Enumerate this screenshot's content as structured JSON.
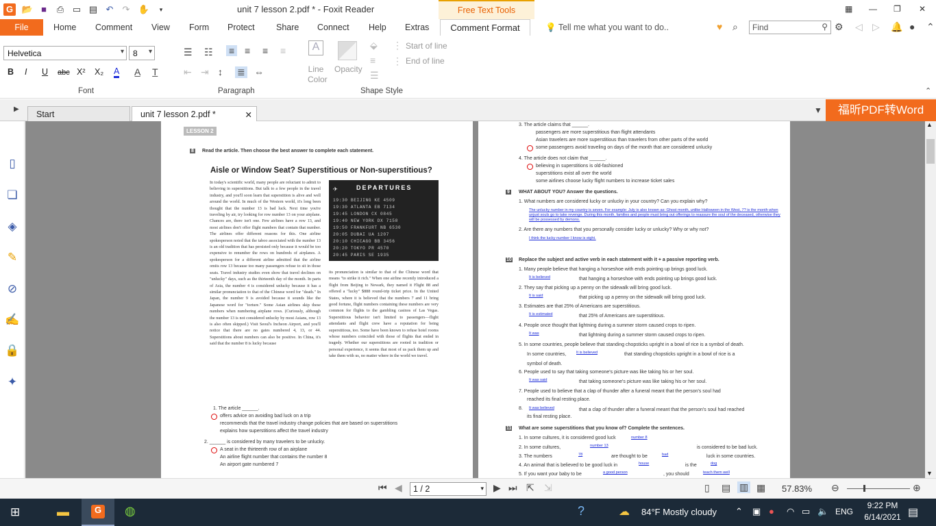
{
  "titlebar": {
    "title": "unit 7 lesson 2.pdf * - Foxit Reader",
    "context_tab": "Free Text Tools"
  },
  "tabs": {
    "file": "File",
    "home": "Home",
    "comment": "Comment",
    "view": "View",
    "form": "Form",
    "protect": "Protect",
    "share": "Share",
    "connect": "Connect",
    "help": "Help",
    "extras": "Extras",
    "comment_format": "Comment Format",
    "tellme": "Tell me what you want to do..",
    "find_placeholder": "Find"
  },
  "ribbon": {
    "font_name": "Helvetica",
    "font_size": "8",
    "bold": "B",
    "italic": "I",
    "underline": "U",
    "strike": "abc",
    "superscript": "X²",
    "subscript": "X₂",
    "font_color": "A",
    "group_font": "Font",
    "group_paragraph": "Paragraph",
    "group_shape": "Shape Style",
    "line_color": "Line Color",
    "opacity": "Opacity",
    "start_of_line": "Start of line",
    "end_of_line": "End of line"
  },
  "doctabs": {
    "start": "Start",
    "doc": "unit 7 lesson 2.pdf *",
    "banner": "福昕PDF转Word"
  },
  "page1": {
    "lesson": "LESSON 2",
    "letter": "8",
    "instruction": "Read the article. Then choose the best answer to complete each statement.",
    "headline": "Aisle or Window Seat? Superstitious or Non-superstitious?",
    "departures": "DEPARTURES",
    "dep_rows": [
      "19:30 BEIJING KE 4509",
      "19:30 ATLANTA EB 7134",
      "19:45 LONDON CX 0845",
      "19:40 NEW YORK DX 7158",
      "19:50 FRANKFURT NB 6530",
      "20:05 DUBAI UA 1207",
      "20:10 CHICAGO BB 3456",
      "20:20 TOKYO PR 4570",
      "20:45 PARIS SE 1935"
    ],
    "col1": "In today's scientific world, many people are reluctant to admit to believing in superstitions. But talk to a few people in the travel industry, and you'll soon learn that superstition is alive and well around the world. In much of the Western world, it's long been thought that the number 13 is bad luck. Next time you're traveling by air, try looking for row number 13 on your airplane. Chances are, there isn't one. Few airlines have a row 13, and most airlines don't offer flight numbers that contain that number. The airlines offer different reasons for this. One airline spokesperson noted that the taboo associated with the number 13 is an old tradition that has persisted only because it would be too expensive to renumber the rows on hundreds of airplanes. A spokesperson for a different airline admitted that the airline omits row 13 because too many passengers refuse to sit in those seats. Travel industry studies even show that travel declines on \"unlucky\" days, such as the thirteenth day of the month. In parts of Asia, the number 4 is considered unlucky because it has a similar pronunciation to that of the Chinese word for \"death.\" In Japan, the number 9 is avoided because it sounds like the Japanese word for \"torture.\" Some Asian airlines skip these numbers when numbering airplane rows. (Curiously, although the number 13 is not considered unlucky by most Asians, row 13 is also often skipped.) Visit Seoul's Incheon Airport, and you'll notice that there are no gates numbered 4, 13, or 44. Superstitions about numbers can also be positive. In China, it's said that the number 8 is lucky because",
    "col2": "its pronunciation is similar to that of the Chinese word that means \"to strike it rich.\" When one airline recently introduced a flight from Beijing to Newark, they named it Flight 88 and offered a \"lucky\" $888 round-trip ticket price. In the United States, where it is believed that the numbers 7 and 11 bring good fortune, flight numbers containing these numbers are very common for flights to the gambling casinos of Las Vegas. Superstitious behavior isn't limited to passengers—flight attendants and flight crew have a reputation for being superstitious, too. Some have been known to refuse hotel rooms whose numbers coincided with those of flights that ended in tragedy. Whether our superstitions are rooted in tradition or personal experience, it seems that most of us pack them up and take them with us, no matter where in the world we travel.",
    "q1": "1.  The article ______.",
    "q1a": "offers advice on avoiding bad luck on a trip",
    "q1b": "recommends that the travel industry change policies that are based on superstitions",
    "q1c": "explains how superstitions affect the travel industry",
    "q2": "2.  ______ is considered by many travelers to be unlucky.",
    "q2a": "A seat in the thirteenth row of an airplane",
    "q2b": "An airline flight number that contains the number 8",
    "q2c": "An airport gate numbered 7"
  },
  "page2": {
    "q3": "3.  The article claims that ______.",
    "q3a": "passengers are more superstitious than flight attendants",
    "q3b": "Asian travelers are more superstitious than travelers from other parts of the world",
    "q3c": "some passengers avoid traveling on days of the month that are considered unlucky",
    "q4": "4.  The article does not claim that ______.",
    "q4a": "believing in superstitions is old-fashioned",
    "q4b": "superstitions exist all over the world",
    "q4c": "some airlines choose lucky flight numbers to increase ticket sales",
    "s9": "WHAT ABOUT YOU? Answer the questions.",
    "s9q1": "1.  What numbers are considered lucky or unlucky in your country? Can you explain why?",
    "s9a1": "The unlucky number in my country is seven. For example: July is also known as: Ghost month, unlike Halloween in the West, 7? is the month when unjust souls go to take revenge. During this month, families and people must bring out offerings to reassure the soul of the deceased, otherwise they will be possessed by demons.",
    "s9q2": "2.  Are there any numbers that you personally consider lucky or unlucky? Why or why not?",
    "s9a2": "I think the lucky number I know is eight.",
    "s10": "Replace the subject and active verb in each statement with it + a passive reporting verb.",
    "s10_items": [
      {
        "q": "1.  Many people believe that hanging a horseshoe with ends pointing up brings good luck.",
        "a": "It is believed",
        "r": "that hanging a horseshoe with ends pointing up brings good luck."
      },
      {
        "q": "2.  They say that picking up a penny on the sidewalk will bring good luck.",
        "a": "It is said",
        "r": "that picking up a penny on the sidewalk will bring good luck."
      },
      {
        "q": "3.  Estimates are that 25% of Americans are superstitious.",
        "a": "It is estimated",
        "r": "that 25% of Americans are superstitious."
      },
      {
        "q": "4.  People once thought that lightning during a summer storm caused crops to ripen.",
        "a": "It was",
        "r": "that lightning during a summer storm caused crops to ripen."
      },
      {
        "q": "5.  In some countries, people believe that standing chopsticks upright in a bowl of rice is a symbol of death.",
        "a": "It is believed",
        "r": "that standing chopsticks upright in a bowl of rice is a"
      },
      {
        "q": "6.  People used to say that taking someone's picture was like taking his or her soul.",
        "a": "It was said",
        "r": "that taking someone's picture was like taking his or her soul."
      },
      {
        "q": "7.  People used to believe that a clap of thunder after a funeral meant that the person's soul had",
        "a": "It was believed",
        "r": "that a clap of thunder after a funeral meant that the person's soul had reached"
      }
    ],
    "s10_5pre": "In some countries,",
    "s10_5end": "symbol of death.",
    "s10_7cont": "reached its final resting place.",
    "s10_8end": "its final resting place.",
    "s11": "What are some superstitions that you know of? Complete the sentences.",
    "s11_1": "1.  In some cultures, it is considered good luck",
    "s11_1a": "number 8",
    "s11_2": "2.  In some cultures,",
    "s11_2a": "number 13",
    "s11_2r": "is considered to be bad luck.",
    "s11_3": "3.  The numbers",
    "s11_3a": "78",
    "s11_3m": "are thought to be",
    "s11_3b": "bad",
    "s11_3r": "luck in some countries.",
    "s11_4": "4.  An animal that is believed to be good luck in",
    "s11_4a": "house",
    "s11_4m": "is the",
    "s11_4b": "dog",
    "s11_5": "5.  If you want your baby to be",
    "s11_5a": "a good person",
    "s11_5m": ", you should",
    "s11_5b": "teach them well"
  },
  "bottombar": {
    "page": "1 / 2",
    "zoom": "57.83%"
  },
  "taskbar": {
    "weather": "84°F  Mostly cloudy",
    "lang": "ENG",
    "time": "9:22 PM",
    "date": "6/14/2021"
  }
}
